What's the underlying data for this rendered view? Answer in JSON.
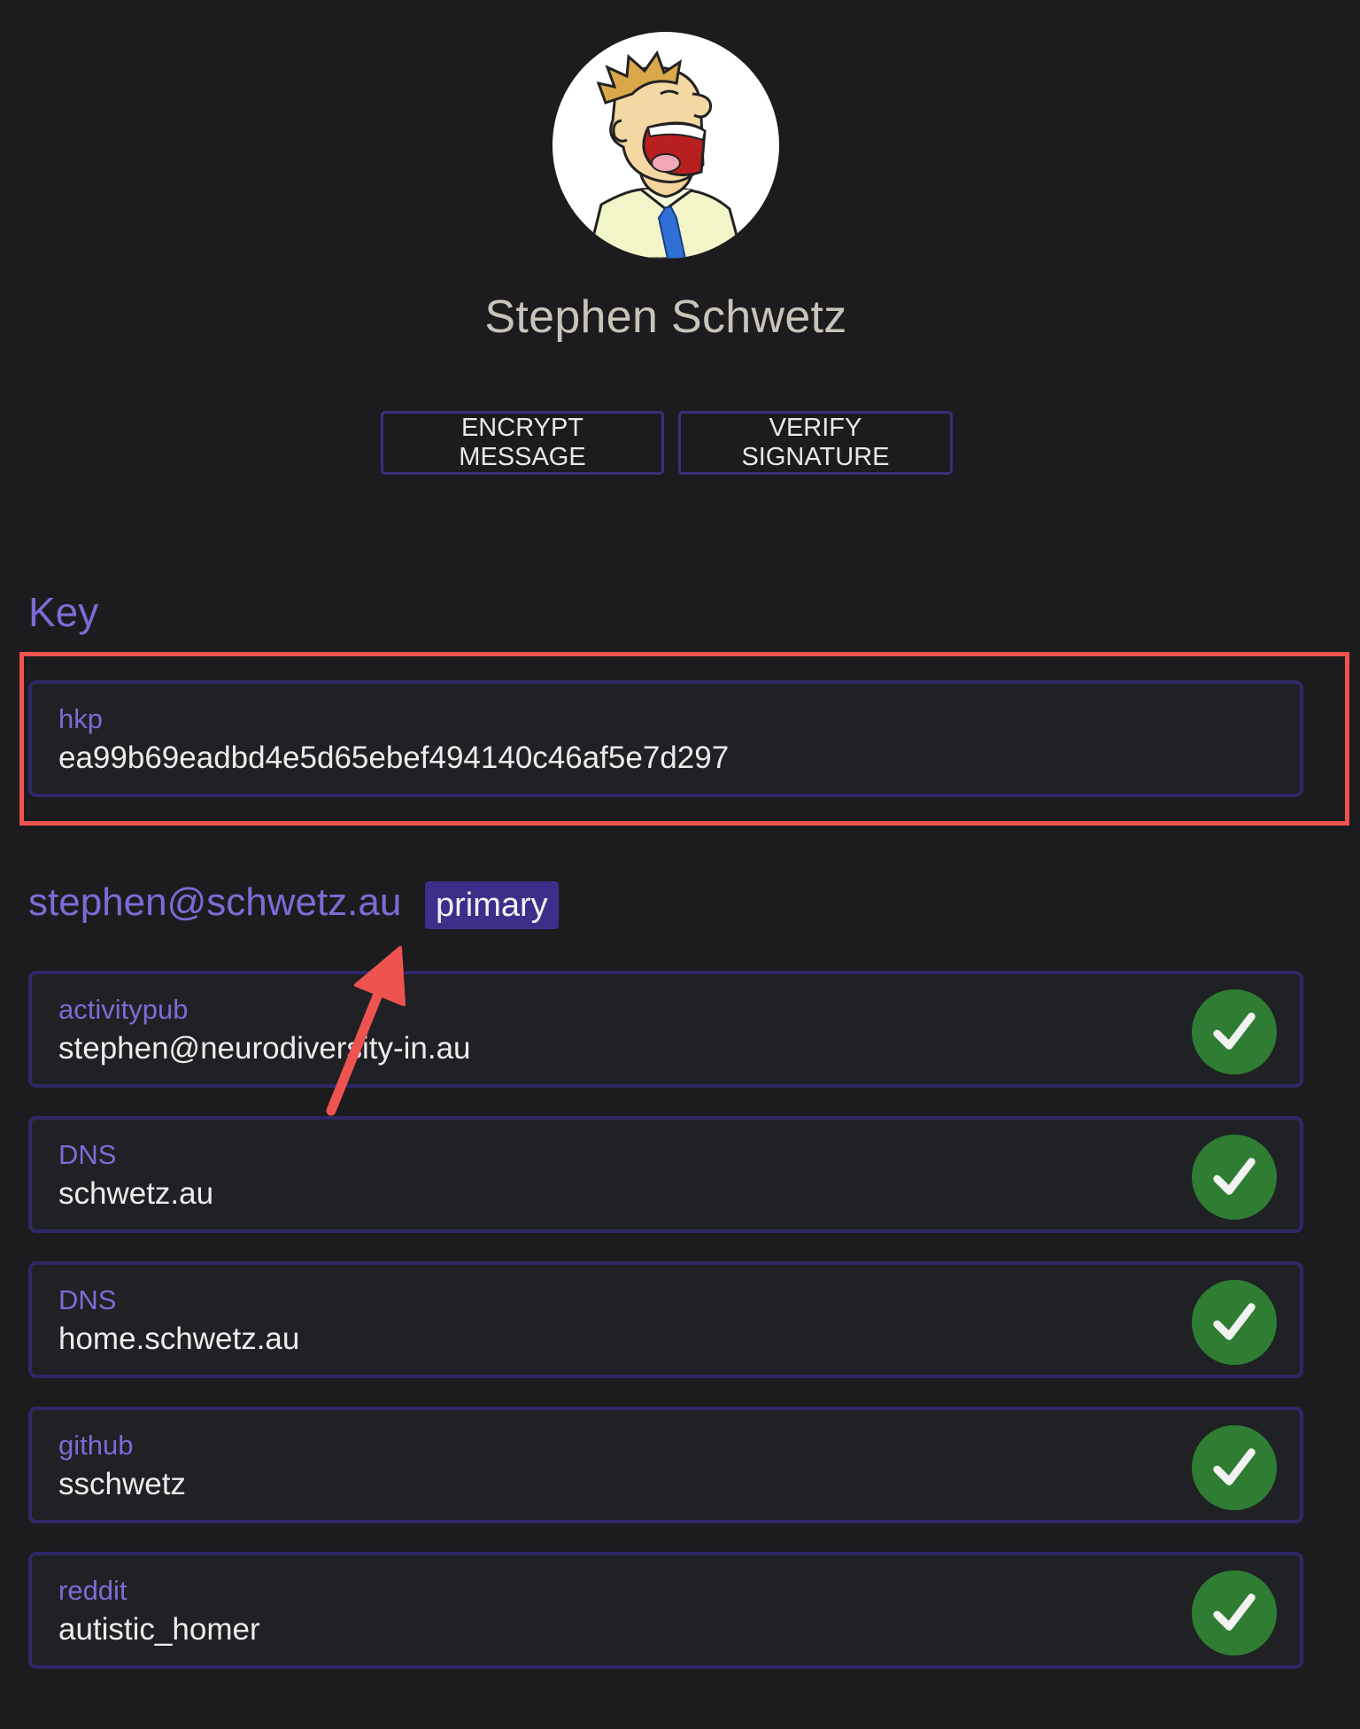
{
  "profile": {
    "name": "Stephen Schwetz",
    "avatar_icon": "cartoon-avatar-icon"
  },
  "actions": {
    "encrypt_label": "ENCRYPT MESSAGE",
    "verify_label": "VERIFY SIGNATURE"
  },
  "key_section": {
    "title": "Key",
    "type": "hkp",
    "fingerprint": "ea99b69eadbd4e5d65ebef494140c46af5e7d297"
  },
  "identity": {
    "email": "stephen@schwetz.au",
    "badge": "primary",
    "claims": [
      {
        "type": "activitypub",
        "value": "stephen@neurodiversity-in.au",
        "verified": true
      },
      {
        "type": "DNS",
        "value": "schwetz.au",
        "verified": true
      },
      {
        "type": "DNS",
        "value": "home.schwetz.au",
        "verified": true
      },
      {
        "type": "github",
        "value": "sschwetz",
        "verified": true
      },
      {
        "type": "reddit",
        "value": "autistic_homer",
        "verified": true
      }
    ]
  },
  "colors": {
    "background": "#1c1c1e",
    "accent": "#7b6cd6",
    "card_border": "#2f2866",
    "badge_bg": "#3b2f8a",
    "verified_green": "#2e7d32",
    "annotation_red": "#ef5350"
  }
}
